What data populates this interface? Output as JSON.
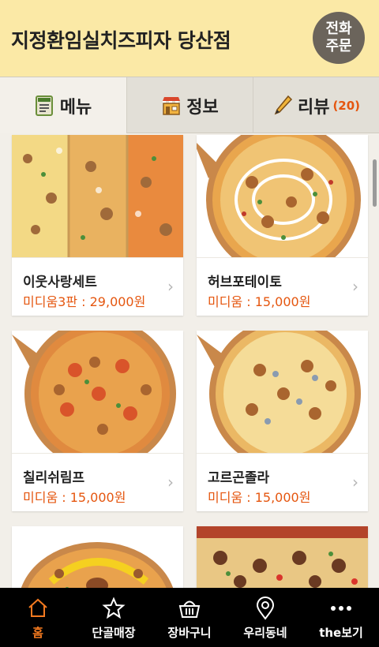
{
  "header": {
    "title": "지정환임실치즈피자 당산점",
    "call_line1": "전화",
    "call_line2": "주문"
  },
  "tabs": [
    {
      "label": "메뉴",
      "icon": "menu-board-icon"
    },
    {
      "label": "정보",
      "icon": "store-icon"
    },
    {
      "label": "리뷰",
      "icon": "pencil-icon",
      "count": "(20)"
    }
  ],
  "menu": [
    {
      "name": "이웃사랑세트",
      "price": "미디움3판 : 29,000원"
    },
    {
      "name": "허브포테이토",
      "price": "미디움 : 15,000원"
    },
    {
      "name": "칠리쉬림프",
      "price": "미디움 : 15,000원"
    },
    {
      "name": "고르곤졸라",
      "price": "미디움 : 15,000원"
    }
  ],
  "nav": [
    {
      "label": "홈",
      "icon": "home-icon"
    },
    {
      "label": "단골매장",
      "icon": "star-icon"
    },
    {
      "label": "장바구니",
      "icon": "basket-icon"
    },
    {
      "label": "우리동네",
      "icon": "map-pin-icon"
    },
    {
      "label": "the보기",
      "icon": "more-dots-icon"
    }
  ],
  "colors": {
    "accent": "#e5560f",
    "header_bg": "#fbe9a6",
    "nav_active": "#f47a20"
  }
}
